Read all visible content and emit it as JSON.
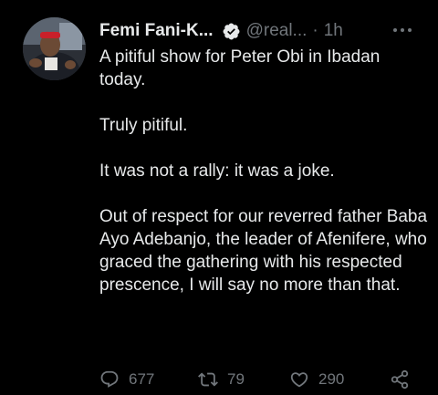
{
  "tweet": {
    "author_name": "Femi Fani-K...",
    "handle": "@real...",
    "separator": "·",
    "time": "1h",
    "paragraphs": [
      "A pitiful show for Peter Obi in Ibadan today.",
      "Truly pitiful.",
      "It was not a rally: it was a joke.",
      "Out of respect for our reverred father Baba Ayo Adebanjo, the leader of Afenifere, who graced the gathering with his respected prescence, I will say no more than that."
    ]
  },
  "actions": {
    "replies": "677",
    "retweets": "79",
    "likes": "290"
  },
  "icons": {
    "verified": "verified-badge-icon",
    "more": "more-options-icon",
    "reply": "reply-icon",
    "retweet": "retweet-icon",
    "like": "heart-icon",
    "share": "share-icon"
  },
  "colors": {
    "background": "#000000",
    "text": "#e7e9ea",
    "secondary": "#71767b",
    "verified_badge": "#e7e9ea"
  }
}
